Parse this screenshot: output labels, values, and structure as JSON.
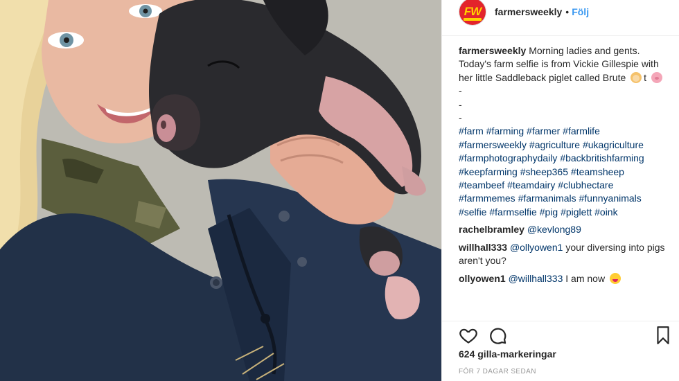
{
  "post": {
    "username": "farmersweekly",
    "avatar_text": "FW",
    "follow_label": "Följ",
    "separator": "•"
  },
  "caption": {
    "username": "farmersweekly",
    "text": "Morning ladies and gents. Today's farm selfie is from Vickie Gillespie with her little Saddleback piglet called Brute",
    "after_emoji": "t",
    "dashes": [
      "-",
      "-",
      "-"
    ],
    "hashtags": [
      "#farm",
      "#farming",
      "#farmer",
      "#farmlife",
      "#farmersweekly",
      "#agriculture",
      "#ukagriculture",
      "#farmphotographydaily",
      "#backbritishfarming",
      "#keepfarming",
      "#sheep365",
      "#teamsheep",
      "#teambeef",
      "#teamdairy",
      "#clubhectare",
      "#farmmemes",
      "#farmanimals",
      "#funnyanimals",
      "#selfie",
      "#farmselfie",
      "#pig",
      "#piglett",
      "#oink"
    ]
  },
  "comments": [
    {
      "user": "rachelbramley",
      "mention": "@kevlong89",
      "text": ""
    },
    {
      "user": "willhall333",
      "mention": "@ollyowen1",
      "text": "your diversing into pigs aren't you?"
    },
    {
      "user": "ollyowen1",
      "mention": "@willhall333",
      "text": "I am now"
    }
  ],
  "actions": {
    "icons": [
      "heart-icon",
      "comment-bubble-icon",
      "bookmark-icon"
    ]
  },
  "likes_label": "624 gilla-markeringar",
  "timestamp": "FÖR 7 DAGAR SEDAN",
  "colors": {
    "link": "#003569",
    "follow": "#3897f0",
    "avatar_bg": "#e3242b",
    "avatar_text": "#ffd200",
    "muted": "#999999"
  }
}
